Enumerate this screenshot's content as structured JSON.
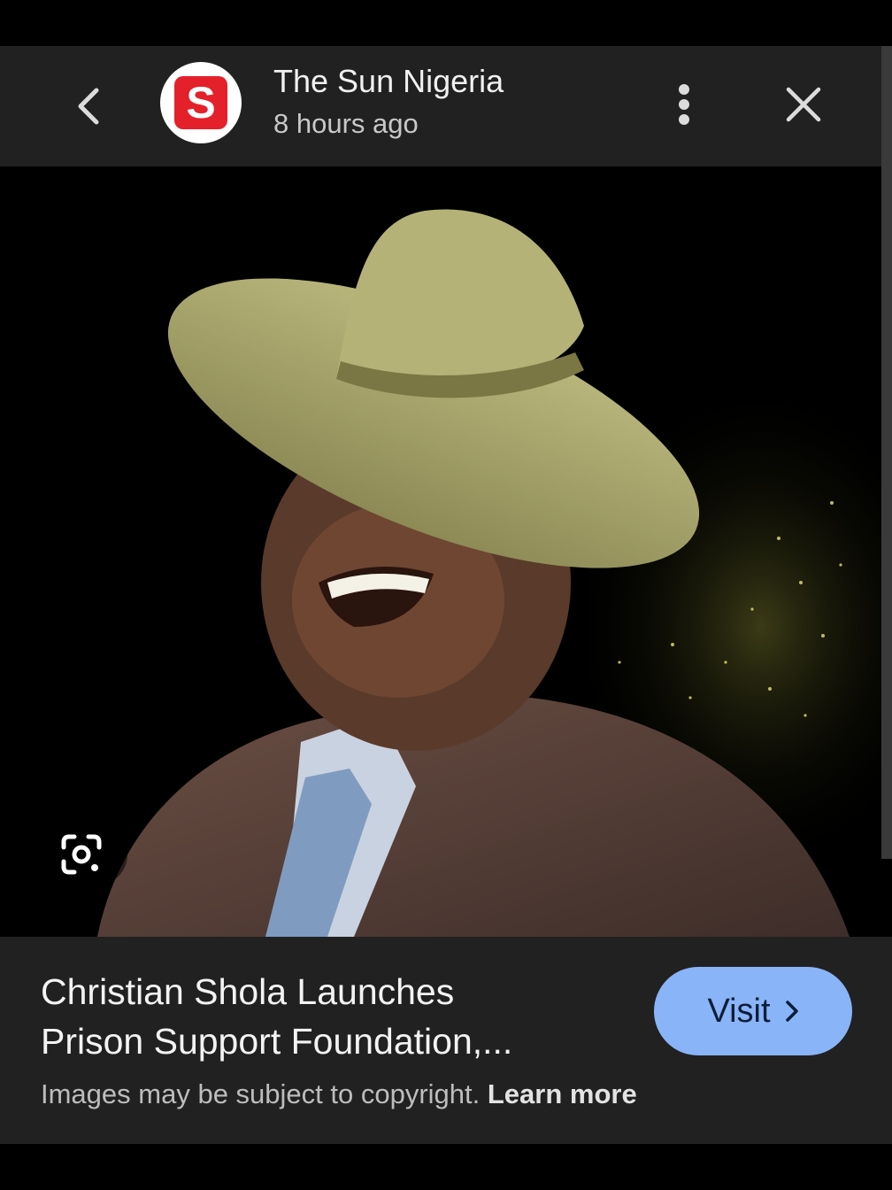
{
  "header": {
    "source_name": "The Sun Nigeria",
    "time_ago": "8 hours ago",
    "logo_letter": "S",
    "icons": {
      "back": "chevron-left-icon",
      "more": "more-vert-icon",
      "close": "close-icon"
    }
  },
  "image": {
    "lens_icon": "google-lens-icon"
  },
  "caption": {
    "title_line1": "Christian Shola Launches",
    "title_line2": "Prison Support Foundation,...",
    "visit_label": "Visit",
    "copyright_text": "Images may be subject to copyright.",
    "learn_more": "Learn more"
  },
  "colors": {
    "bar_bg": "#212121",
    "accent_button": "#8ab4f8",
    "logo_red": "#e4202b"
  }
}
